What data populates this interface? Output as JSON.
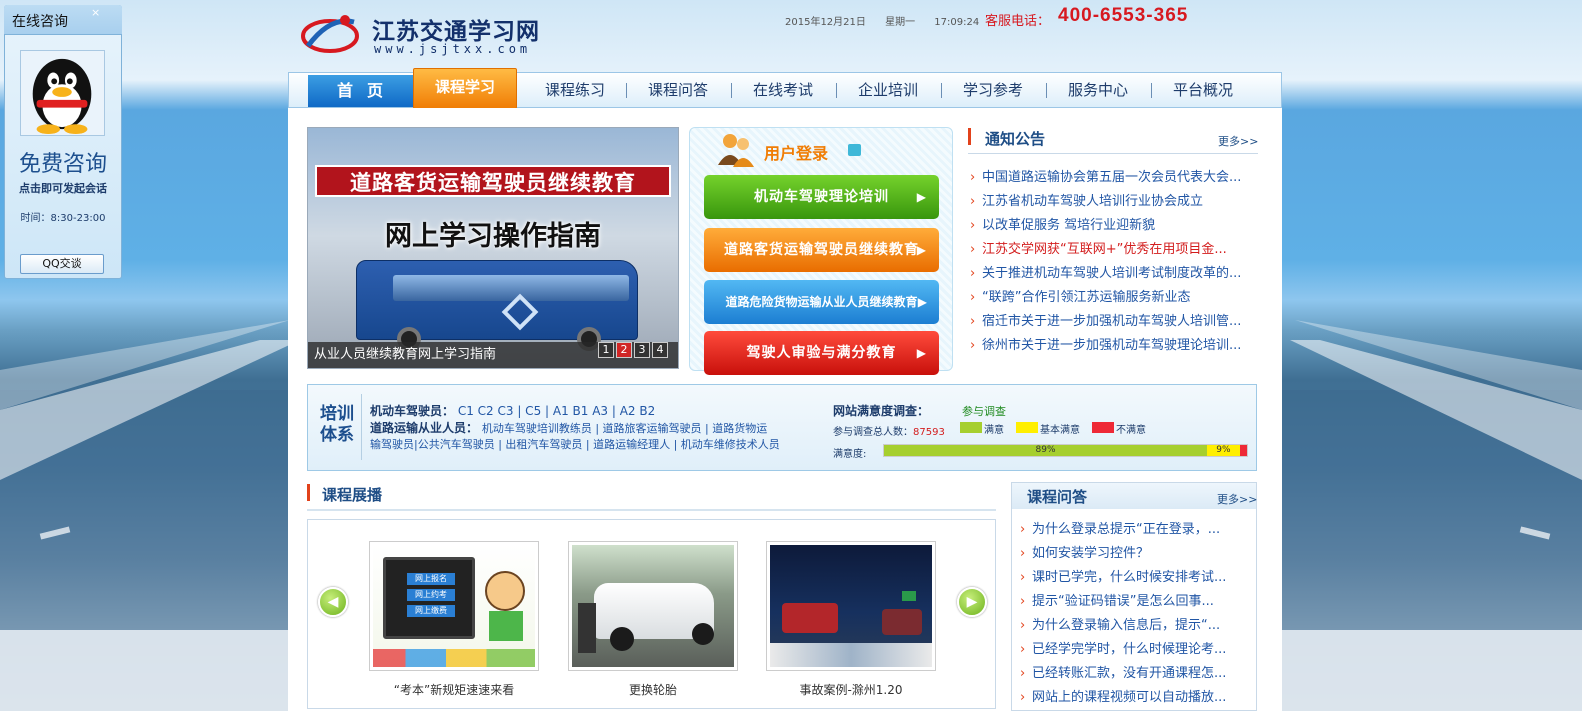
{
  "float_widget": {
    "title": "在线咨询",
    "close": "×",
    "free_label": "免费咨询",
    "sub_label": "点击即可发起会话",
    "time_label": "时间：8:30-23:00",
    "button_label": "QQ交谈"
  },
  "header": {
    "site_title": "江苏交通学习网",
    "site_url": "www.jsjtxx.com",
    "date": "2015年12月21日",
    "weekday": "星期一",
    "time": "17:09:24",
    "phone_label": "客服电话：",
    "phone": "400-6553-365"
  },
  "nav": {
    "items": [
      "首页",
      "课程学习",
      "课程练习",
      "课程问答",
      "在线考试",
      "企业培训",
      "学习参考",
      "服务中心",
      "平台概况"
    ]
  },
  "slider": {
    "banner_line1": "道路客货运输驾驶员继续教育",
    "banner_line2": "网上学习操作指南",
    "caption": "从业人员继续教育网上学习指南",
    "pages": [
      "1",
      "2",
      "3",
      "4"
    ],
    "active_page": 2
  },
  "login": {
    "title": "用户登录",
    "buttons": [
      "机动车驾驶理论培训",
      "道路客货运输驾驶员继续教育",
      "道路危险货物运输从业人员继续教育",
      "驾驶人审验与满分教育"
    ],
    "arrow": "▶"
  },
  "notice": {
    "title": "通知公告",
    "more": "更多>>",
    "items": [
      {
        "text": "中国道路运输协会第五届一次会员代表大会...",
        "highlight": false
      },
      {
        "text": "江苏省机动车驾驶人培训行业协会成立",
        "highlight": false
      },
      {
        "text": "以改革促服务 驾培行业迎新貌",
        "highlight": false
      },
      {
        "text": "江苏交学网获“互联网+”优秀在用项目金...",
        "highlight": true
      },
      {
        "text": "关于推进机动车驾驶人培训考试制度改革的...",
        "highlight": false
      },
      {
        "text": "“联跨”合作引领江苏运输服务新业态",
        "highlight": false
      },
      {
        "text": "宿迁市关于进一步加强机动车驾驶人培训管...",
        "highlight": false
      },
      {
        "text": "徐州市关于进一步加强机动车驾驶理论培训...",
        "highlight": false
      }
    ]
  },
  "training": {
    "label_line1": "培训",
    "label_line2": "体系",
    "motor_label": "机动车驾驶员：",
    "motor_values": "C1 C2 C3 | C5 | A1 B1 A3 | A2 B2",
    "road_label": "道路运输从业人员：",
    "road_values_1": "机动车驾驶培训教练员 | 道路旅客运输驾驶员 | 道路货物运",
    "road_values_2": "输驾驶员|公共汽车驾驶员 | 出租汽车驾驶员 | 道路运输经理人 | 机动车维修技术人员"
  },
  "survey": {
    "title": "网站满意度调查：",
    "join": "参与调查",
    "count_label": "参与调查总人数：",
    "count": "87593",
    "legend": [
      {
        "label": "满意",
        "color": "#a6cf2e"
      },
      {
        "label": "基本满意",
        "color": "#ffef00"
      },
      {
        "label": "不满意",
        "color": "#ee2936"
      }
    ],
    "sat_label": "满意度:",
    "satisfied_pct": 89,
    "basic_pct": 9,
    "unsatisfied_pct": 2,
    "satisfied_text": "89%",
    "basic_text": "9%"
  },
  "course_display": {
    "title": "课程展播",
    "items": [
      {
        "caption": "“考本”新规矩速速来看",
        "thumb_labels": [
          "网上报名",
          "网上约考",
          "网上缴费"
        ]
      },
      {
        "caption": "更换轮胎"
      },
      {
        "caption": "事故案例-滁州1.20"
      }
    ],
    "prev": "◀",
    "next": "▶"
  },
  "faq": {
    "title": "课程问答",
    "more": "更多>>",
    "items": [
      "为什么登录总提示“正在登录，...",
      "如何安装学习控件？",
      "课时已学完，什么时候安排考试...",
      "提示“验证码错误”是怎么回事...",
      "为什么登录输入信息后，提示“...",
      "已经学完学时，什么时候理论考...",
      "已经转账汇款，没有开通课程怎...",
      "网站上的课程视频可以自动播放..."
    ]
  }
}
